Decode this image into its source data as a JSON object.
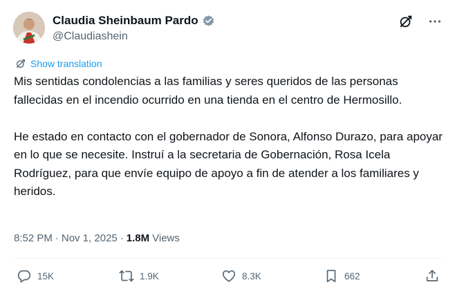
{
  "author": {
    "display_name": "Claudia Sheinbaum Pardo",
    "handle": "@Claudiashein",
    "verified": true
  },
  "translate_label": "Show translation",
  "body": {
    "paragraph1": "Mis sentidas condolencias a las familias y seres queridos de las personas fallecidas en el incendio ocurrido en una tienda en el centro de Hermosillo.",
    "paragraph2": "He estado en contacto con el gobernador de Sonora, Alfonso Durazo, para apoyar en lo que se necesite. Instruí a la secretaria de Gobernación, Rosa Icela Rodríguez, para que envíe equipo de apoyo a fin de atender a los familiares y heridos."
  },
  "meta": {
    "time": "8:52 PM",
    "separator": "·",
    "date": "Nov 1, 2025",
    "views_count": "1.8M",
    "views_label": "Views"
  },
  "actions": {
    "replies": "15K",
    "reposts": "1.9K",
    "likes": "8.3K",
    "bookmarks": "662"
  },
  "colors": {
    "text": "#0f1419",
    "secondary": "#536471",
    "link": "#1d9bf0",
    "verified_badge": "#829aab"
  }
}
